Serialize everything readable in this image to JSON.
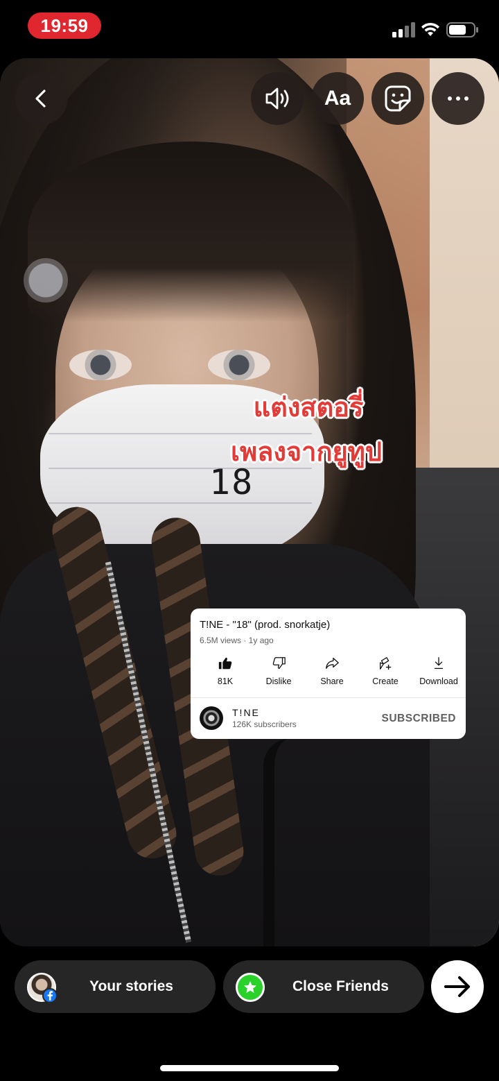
{
  "status_bar": {
    "time": "19:59",
    "icons": [
      "cellular-signal-icon",
      "wifi-icon",
      "battery-icon"
    ],
    "time_pill_color": "#e0262f"
  },
  "top_controls": {
    "back_icon": "chevron-left-icon",
    "sound_icon": "speaker-icon",
    "text_button_label": "Aa",
    "sticker_icon": "sticker-icon",
    "more_icon": "more-horizontal-icon"
  },
  "story": {
    "text_line_1": "แต่งสตอรี่",
    "text_line_2": "เพลงจากยูทูป",
    "text_color": "#e23b38",
    "number_sticker": "18"
  },
  "youtube_card": {
    "title": "T!NE - \"18\" (prod. snorkatje)",
    "meta": "6.5M views · 1y ago",
    "actions": [
      {
        "label": "81K",
        "icon": "thumbs-up-icon"
      },
      {
        "label": "Dislike",
        "icon": "thumbs-down-icon"
      },
      {
        "label": "Share",
        "icon": "share-icon"
      },
      {
        "label": "Create",
        "icon": "create-icon"
      },
      {
        "label": "Download",
        "icon": "download-icon"
      }
    ],
    "channel_name": "T!NE",
    "subscribers": "126K subscribers",
    "subscribe_state": "SUBSCRIBED"
  },
  "bottom_bar": {
    "your_stories_label": "Your stories",
    "close_friends_label": "Close Friends",
    "close_friends_color": "#2bd12b",
    "next_icon": "arrow-right-icon"
  }
}
